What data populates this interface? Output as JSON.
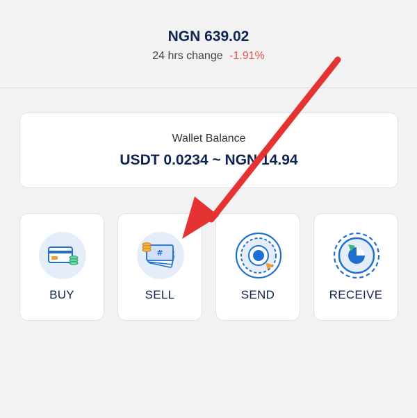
{
  "ticker": {
    "price": "NGN 639.02",
    "change_label": "24 hrs change",
    "change_value": "-1.91%"
  },
  "wallet": {
    "label": "Wallet Balance",
    "amount": "USDT 0.0234 ~ NGN 14.94"
  },
  "actions": [
    {
      "label": "BUY",
      "icon": "card-coins-icon"
    },
    {
      "label": "SELL",
      "icon": "cash-stack-icon"
    },
    {
      "label": "SEND",
      "icon": "send-icon"
    },
    {
      "label": "RECEIVE",
      "icon": "receive-icon"
    }
  ],
  "colors": {
    "primary_text": "#0f2350",
    "negative": "#e65248",
    "icon_blue": "#1f6fd1",
    "icon_circle": "#e4edf9",
    "annotation": "#e53333"
  }
}
